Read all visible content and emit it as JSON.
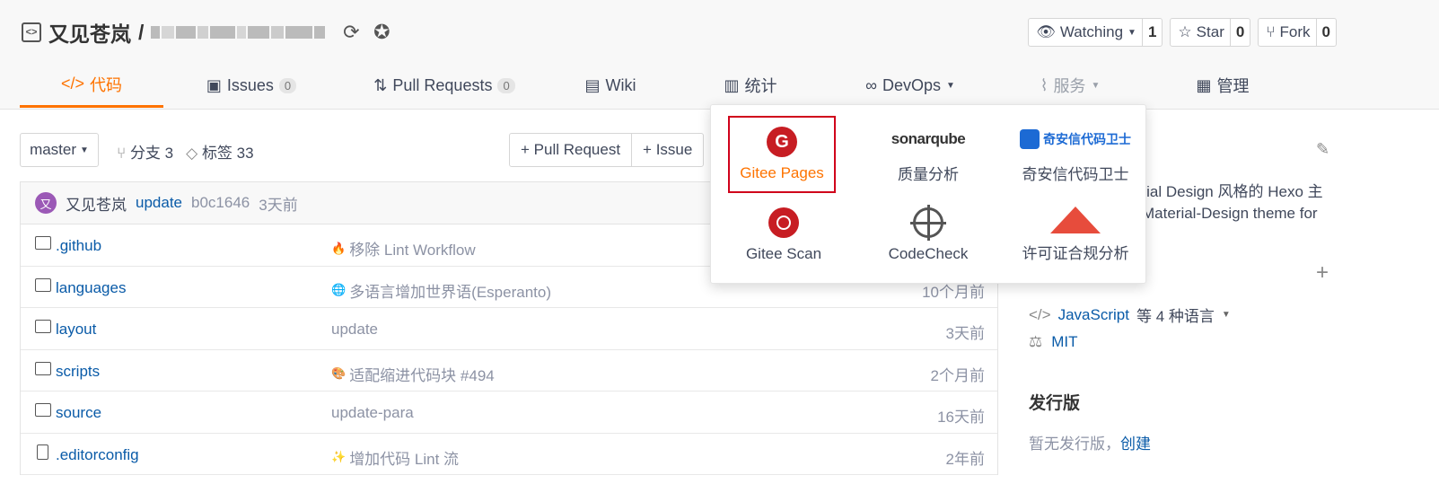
{
  "repo": {
    "owner": "又见苍岚",
    "slash": "/"
  },
  "actions": {
    "watch_label": "Watching",
    "watch_count": "1",
    "star_label": "Star",
    "star_count": "0",
    "fork_label": "Fork",
    "fork_count": "0"
  },
  "tabs": [
    {
      "label": "代码",
      "icon": "code-icon"
    },
    {
      "label": "Issues",
      "badge": "0",
      "icon": "issues-icon"
    },
    {
      "label": "Pull Requests",
      "badge": "0",
      "icon": "pull-request-icon"
    },
    {
      "label": "Wiki",
      "icon": "wiki-icon"
    },
    {
      "label": "统计",
      "icon": "chart-icon"
    },
    {
      "label": "DevOps",
      "icon": "devops-icon"
    },
    {
      "label": "服务",
      "icon": "pulse-icon"
    },
    {
      "label": "管理",
      "icon": "manage-icon"
    }
  ],
  "toolbar": {
    "branch": "master",
    "branches": "分支 3",
    "tags": "标签 33",
    "pull_request": "+ Pull Request",
    "issue": "+ Issue"
  },
  "commit": {
    "avatar_letter": "又",
    "author": "又见苍岚",
    "message": "update",
    "sha": "b0c1646",
    "time": "3天前"
  },
  "files": [
    {
      "name": ".github",
      "msg": "移除 Lint Workflow",
      "emoji": "🔥",
      "time": ""
    },
    {
      "name": "languages",
      "msg": "多语言增加世界语(Esperanto)",
      "emoji": "🌐",
      "time": "10个月前"
    },
    {
      "name": "layout",
      "msg": "update",
      "emoji": "",
      "time": "3天前"
    },
    {
      "name": "scripts",
      "msg": "适配缩进代码块 #494",
      "emoji": "🎨",
      "time": "2个月前"
    },
    {
      "name": "source",
      "msg": "update-para",
      "emoji": "",
      "time": "16天前"
    },
    {
      "name": ".editorconfig",
      "msg": "增加代码 Lint 流",
      "emoji": "✨",
      "time": "2年前"
    }
  ],
  "sidebar": {
    "desc_line1": "erial Design 风格的 Hexo 主",
    "desc_line2": "Material-Design theme for",
    "language": "JavaScript",
    "language_rest": "等 4 种语言",
    "license": "MIT",
    "release_heading": "发行版",
    "release_text": "暂无发行版，",
    "release_link": "创建"
  },
  "dropdown": [
    {
      "label": "Gitee Pages",
      "selected": true
    },
    {
      "label": "质量分析",
      "logo_text": "sonarqube"
    },
    {
      "label": "奇安信代码卫士",
      "logo_text": "奇安信代码卫士"
    },
    {
      "label": "Gitee Scan"
    },
    {
      "label": "CodeCheck"
    },
    {
      "label": "许可证合规分析"
    }
  ],
  "colors": {
    "accent": "#fe7300",
    "link": "#0a5ba8",
    "gitee_red": "#c71d23",
    "selected_border": "#d0021b"
  }
}
